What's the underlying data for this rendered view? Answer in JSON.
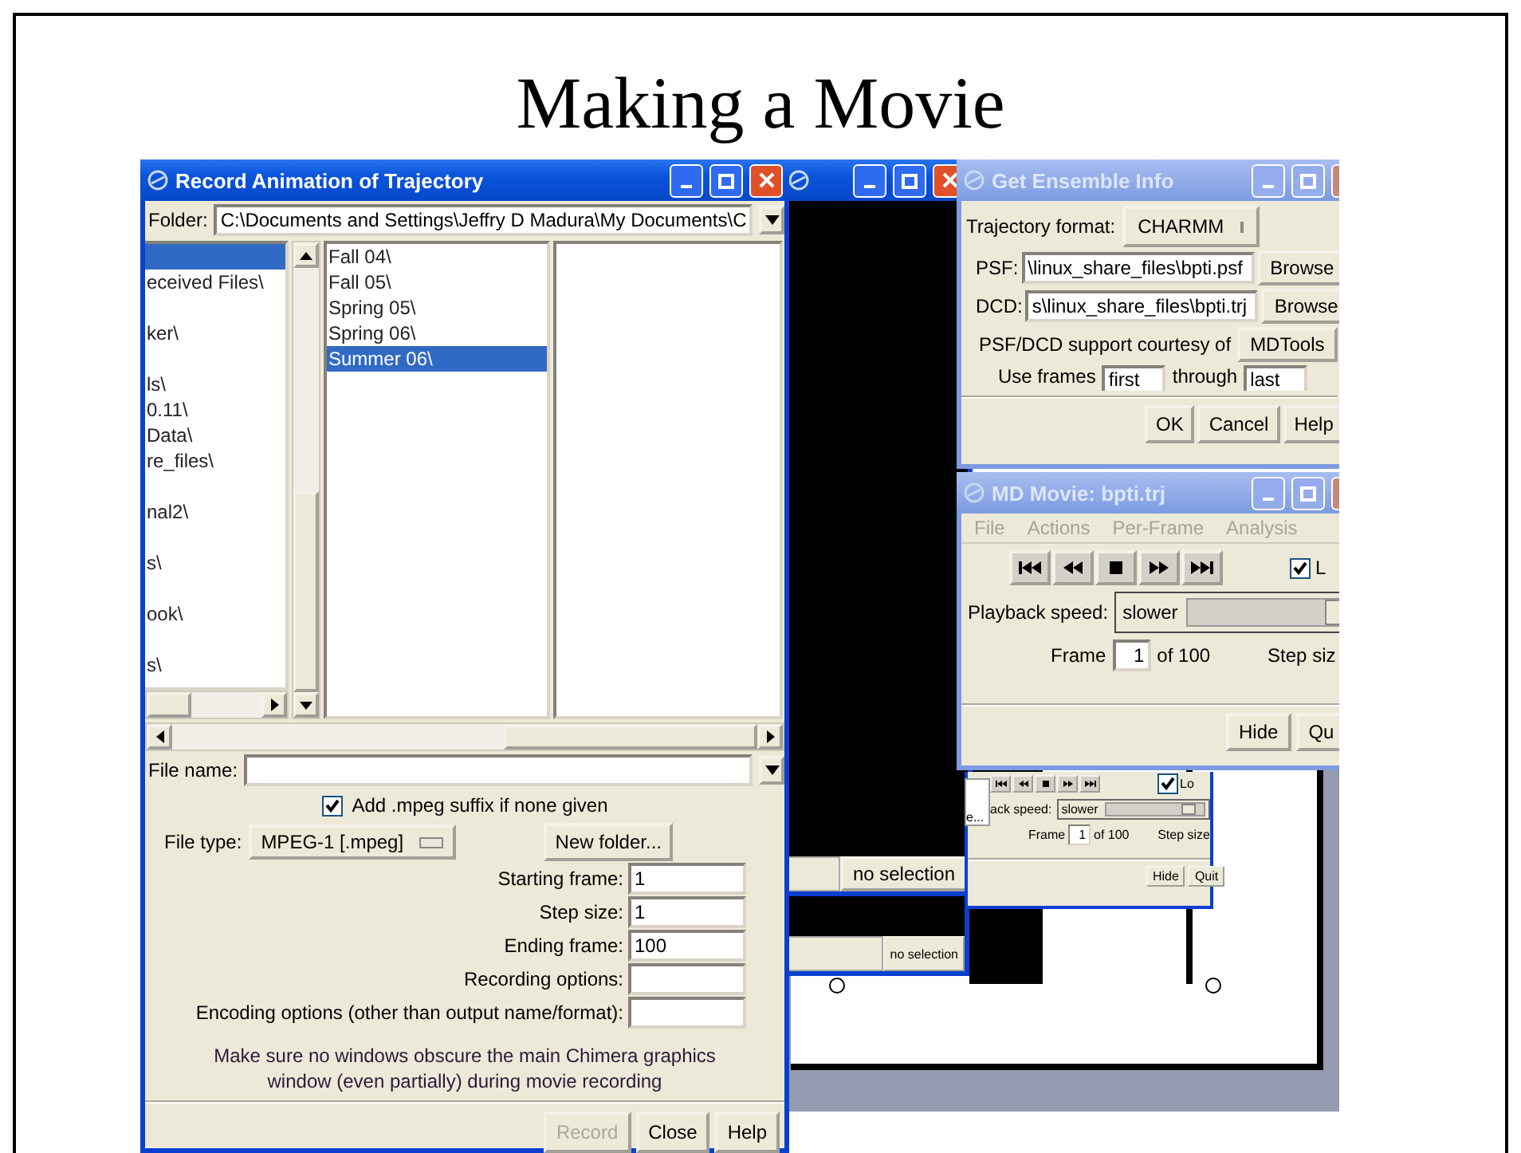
{
  "slide": {
    "title": "Making a Movie"
  },
  "graphics_windows": [
    {
      "status_button": "no selection"
    },
    {
      "status_button": "no selection"
    }
  ],
  "record_window": {
    "title": "Record Animation of Trajectory",
    "folder_label": "Folder:",
    "folder_value": "C:\\Documents and Settings\\Jeffry D Madura\\My Documents\\C",
    "left_list": [
      "eceived Files\\",
      "ker\\",
      "ls\\",
      "0.11\\",
      "Data\\",
      "re_files\\",
      "nal2\\",
      "s\\",
      "ook\\",
      "s\\"
    ],
    "middle_list": [
      {
        "label": "Fall 04\\",
        "selected": false
      },
      {
        "label": "Fall 05\\",
        "selected": false
      },
      {
        "label": "Spring 05\\",
        "selected": false
      },
      {
        "label": "Spring 06\\",
        "selected": false
      },
      {
        "label": "Summer 06\\",
        "selected": true
      }
    ],
    "file_name_label": "File name:",
    "suffix_checkbox": {
      "label": "Add .mpeg suffix if none given",
      "checked": true
    },
    "file_type_label": "File type:",
    "file_type_value": "MPEG-1 [.mpeg]",
    "new_folder_button": "New folder...",
    "fields": [
      {
        "label": "Starting frame:",
        "value": "1"
      },
      {
        "label": "Step size:",
        "value": "1"
      },
      {
        "label": "Ending frame:",
        "value": "100"
      },
      {
        "label": "Recording options:"
      },
      {
        "label": "Encoding options (other than output name/format):"
      }
    ],
    "note": "Make sure no windows obscure the main Chimera graphics window (even partially) during movie recording",
    "buttons": [
      {
        "label": "Record",
        "disabled": true
      },
      {
        "label": "Close",
        "disabled": false
      },
      {
        "label": "Help",
        "disabled": false
      }
    ]
  },
  "ensemble_window": {
    "title": "Get Ensemble Info",
    "format_label": "Trajectory format:",
    "format_value": "CHARMM",
    "files": [
      {
        "label": "PSF:",
        "value": "\\linux_share_files\\bpti.psf",
        "button": "Browse"
      },
      {
        "label": "DCD:",
        "value": "s\\linux_share_files\\bpti.trj",
        "button": "Browse"
      }
    ],
    "credit": "PSF/DCD support courtesy of",
    "credit_button": "MDTools",
    "frames_label": "Use frames",
    "first_value": "first",
    "through_label": "through",
    "last_value": "last",
    "buttons": [
      "OK",
      "Cancel",
      "Help"
    ]
  },
  "movie_window": {
    "title": "MD Movie: bpti.trj",
    "menu": [
      "File",
      "Actions",
      "Per-Frame",
      "Analysis"
    ],
    "loop_checkbox": {
      "label": "L",
      "checked": true
    },
    "speed_label": "Playback speed:",
    "speed_value": "slower",
    "speed_slider": {
      "level": 0.85
    },
    "frame_label": "Frame",
    "frame_value": "1",
    "frame_total": "of 100",
    "step_label": "Step siz",
    "buttons": [
      "Hide",
      "Qu"
    ]
  },
  "movie_thumbnail": {
    "loop_checkbox": {
      "label": "Lo",
      "checked": true
    },
    "menu_fragment": "e...",
    "speed_label": "ack speed:",
    "speed_value": "slower",
    "speed_slider": {
      "level": 0.85
    },
    "frame_label": "Frame",
    "frame_value": "1",
    "frame_total": "of 100",
    "step_label": "Step size",
    "buttons": [
      "Hide",
      "Quit"
    ]
  }
}
